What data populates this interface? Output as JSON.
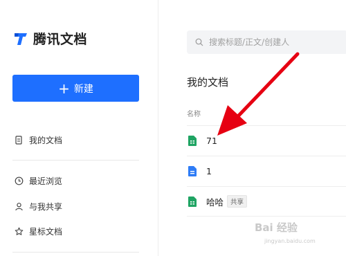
{
  "app": {
    "name": "腾讯文档"
  },
  "sidebar": {
    "new_button": "新建",
    "items": [
      {
        "label": "我的文档",
        "icon": "document-icon"
      },
      {
        "label": "最近浏览",
        "icon": "clock-icon"
      },
      {
        "label": "与我共享",
        "icon": "user-icon"
      },
      {
        "label": "星标文档",
        "icon": "star-icon"
      }
    ]
  },
  "search": {
    "placeholder": "搜索标题/正文/创建人"
  },
  "main": {
    "title": "我的文档",
    "column_name": "名称",
    "files": [
      {
        "name": "71",
        "type": "sheet",
        "tag": ""
      },
      {
        "name": "1",
        "type": "doc",
        "tag": ""
      },
      {
        "name": "哈哈",
        "type": "sheet",
        "tag": "共享"
      }
    ]
  },
  "colors": {
    "accent": "#1e6fff",
    "sheet": "#1fa463",
    "doc": "#2e7cf6",
    "arrow": "#e60012"
  },
  "watermark": {
    "text": "Bai 经验",
    "sub": "jingyan.baidu.com"
  }
}
